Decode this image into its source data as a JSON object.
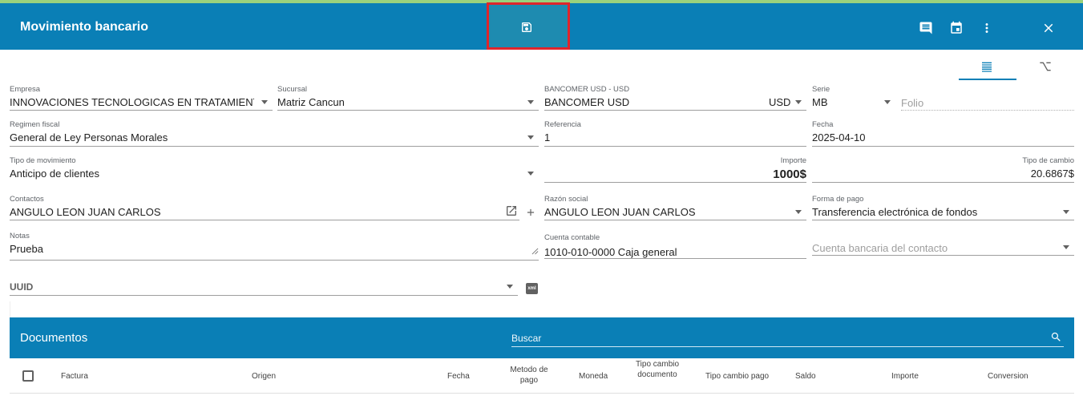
{
  "header": {
    "title": "Movimiento bancario",
    "accent": "#0a7fb6",
    "actions": [
      "save-icon",
      "comment-icon",
      "calendar-icon",
      "more-vert-icon",
      "close-icon"
    ]
  },
  "form": {
    "empresa": {
      "label": "Empresa",
      "value": "INNOVACIONES TECNOLOGICAS EN TRATAMIENTO D"
    },
    "sucursal": {
      "label": "Sucursal",
      "value": "Matriz Cancun"
    },
    "banco": {
      "label": "BANCOMER USD - USD",
      "value": "BANCOMER USD",
      "currency": "USD"
    },
    "serie": {
      "label": "Serie",
      "value": "MB"
    },
    "folio": {
      "placeholder": "Folio"
    },
    "regimen": {
      "label": "Regimen fiscal",
      "value": "General de Ley Personas Morales"
    },
    "referencia": {
      "label": "Referencia",
      "value": "1"
    },
    "fecha": {
      "label": "Fecha",
      "value": "2025-04-10"
    },
    "tipo_mov": {
      "label": "Tipo de movimiento",
      "value": "Anticipo de clientes"
    },
    "importe": {
      "label": "Importe",
      "value": "1000$"
    },
    "tipo_cambio": {
      "label": "Tipo de cambio",
      "value": "20.6867$"
    },
    "contactos": {
      "label": "Contactos",
      "value": "ANGULO LEON JUAN CARLOS"
    },
    "razon": {
      "label": "Razón social",
      "value": "ANGULO LEON JUAN CARLOS"
    },
    "forma_pago": {
      "label": "Forma de pago",
      "value": "Transferencia electrónica de fondos"
    },
    "notas": {
      "label": "Notas",
      "value": "Prueba"
    },
    "cuenta_contable": {
      "label": "Cuenta contable",
      "value": "1010-010-0000 Caja general"
    },
    "cuenta_bancaria": {
      "placeholder": "Cuenta bancaria del contacto"
    },
    "uuid": {
      "placeholder": "UUID"
    }
  },
  "documentos": {
    "title": "Documentos",
    "search_placeholder": "Buscar",
    "columns": [
      "Factura",
      "Origen",
      "Fecha",
      "Metodo de pago",
      "Moneda",
      "Tipo cambio documento",
      "Tipo cambio pago",
      "Saldo",
      "Importe",
      "Conversion"
    ]
  }
}
